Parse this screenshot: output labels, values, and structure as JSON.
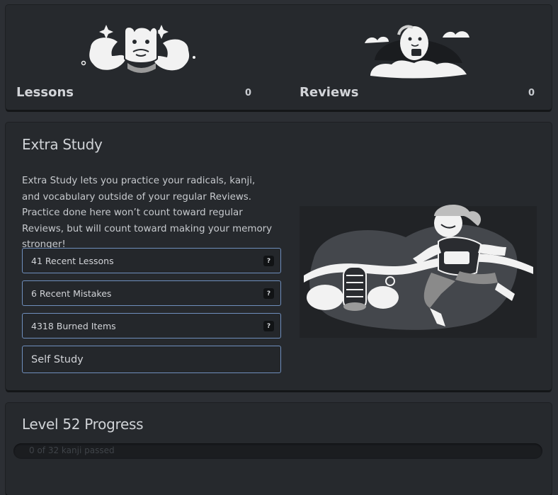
{
  "summary": {
    "lessons": {
      "label": "Lessons",
      "count": "0"
    },
    "reviews": {
      "label": "Reviews",
      "count": "0"
    }
  },
  "extra_study": {
    "title": "Extra Study",
    "description": "Extra Study lets you practice your radicals, kanji, and vocabulary outside of your regular Reviews. Practice done here won’t count toward regular Reviews, but will count toward making your memory stronger!",
    "buttons": [
      {
        "label": "41 Recent Lessons",
        "help": "?"
      },
      {
        "label": "6 Recent Mistakes",
        "help": "?"
      },
      {
        "label": "4318 Burned Items",
        "help": "?"
      },
      {
        "label": "Self Study"
      }
    ]
  },
  "level_progress": {
    "title": "Level 52 Progress",
    "bar_text": "0 of 32 kanji passed",
    "passed": 0,
    "total": 32
  },
  "colors": {
    "page_bg": "#2c2f34",
    "card_bg": "#26292d",
    "button_border": "#6f8fbd"
  }
}
